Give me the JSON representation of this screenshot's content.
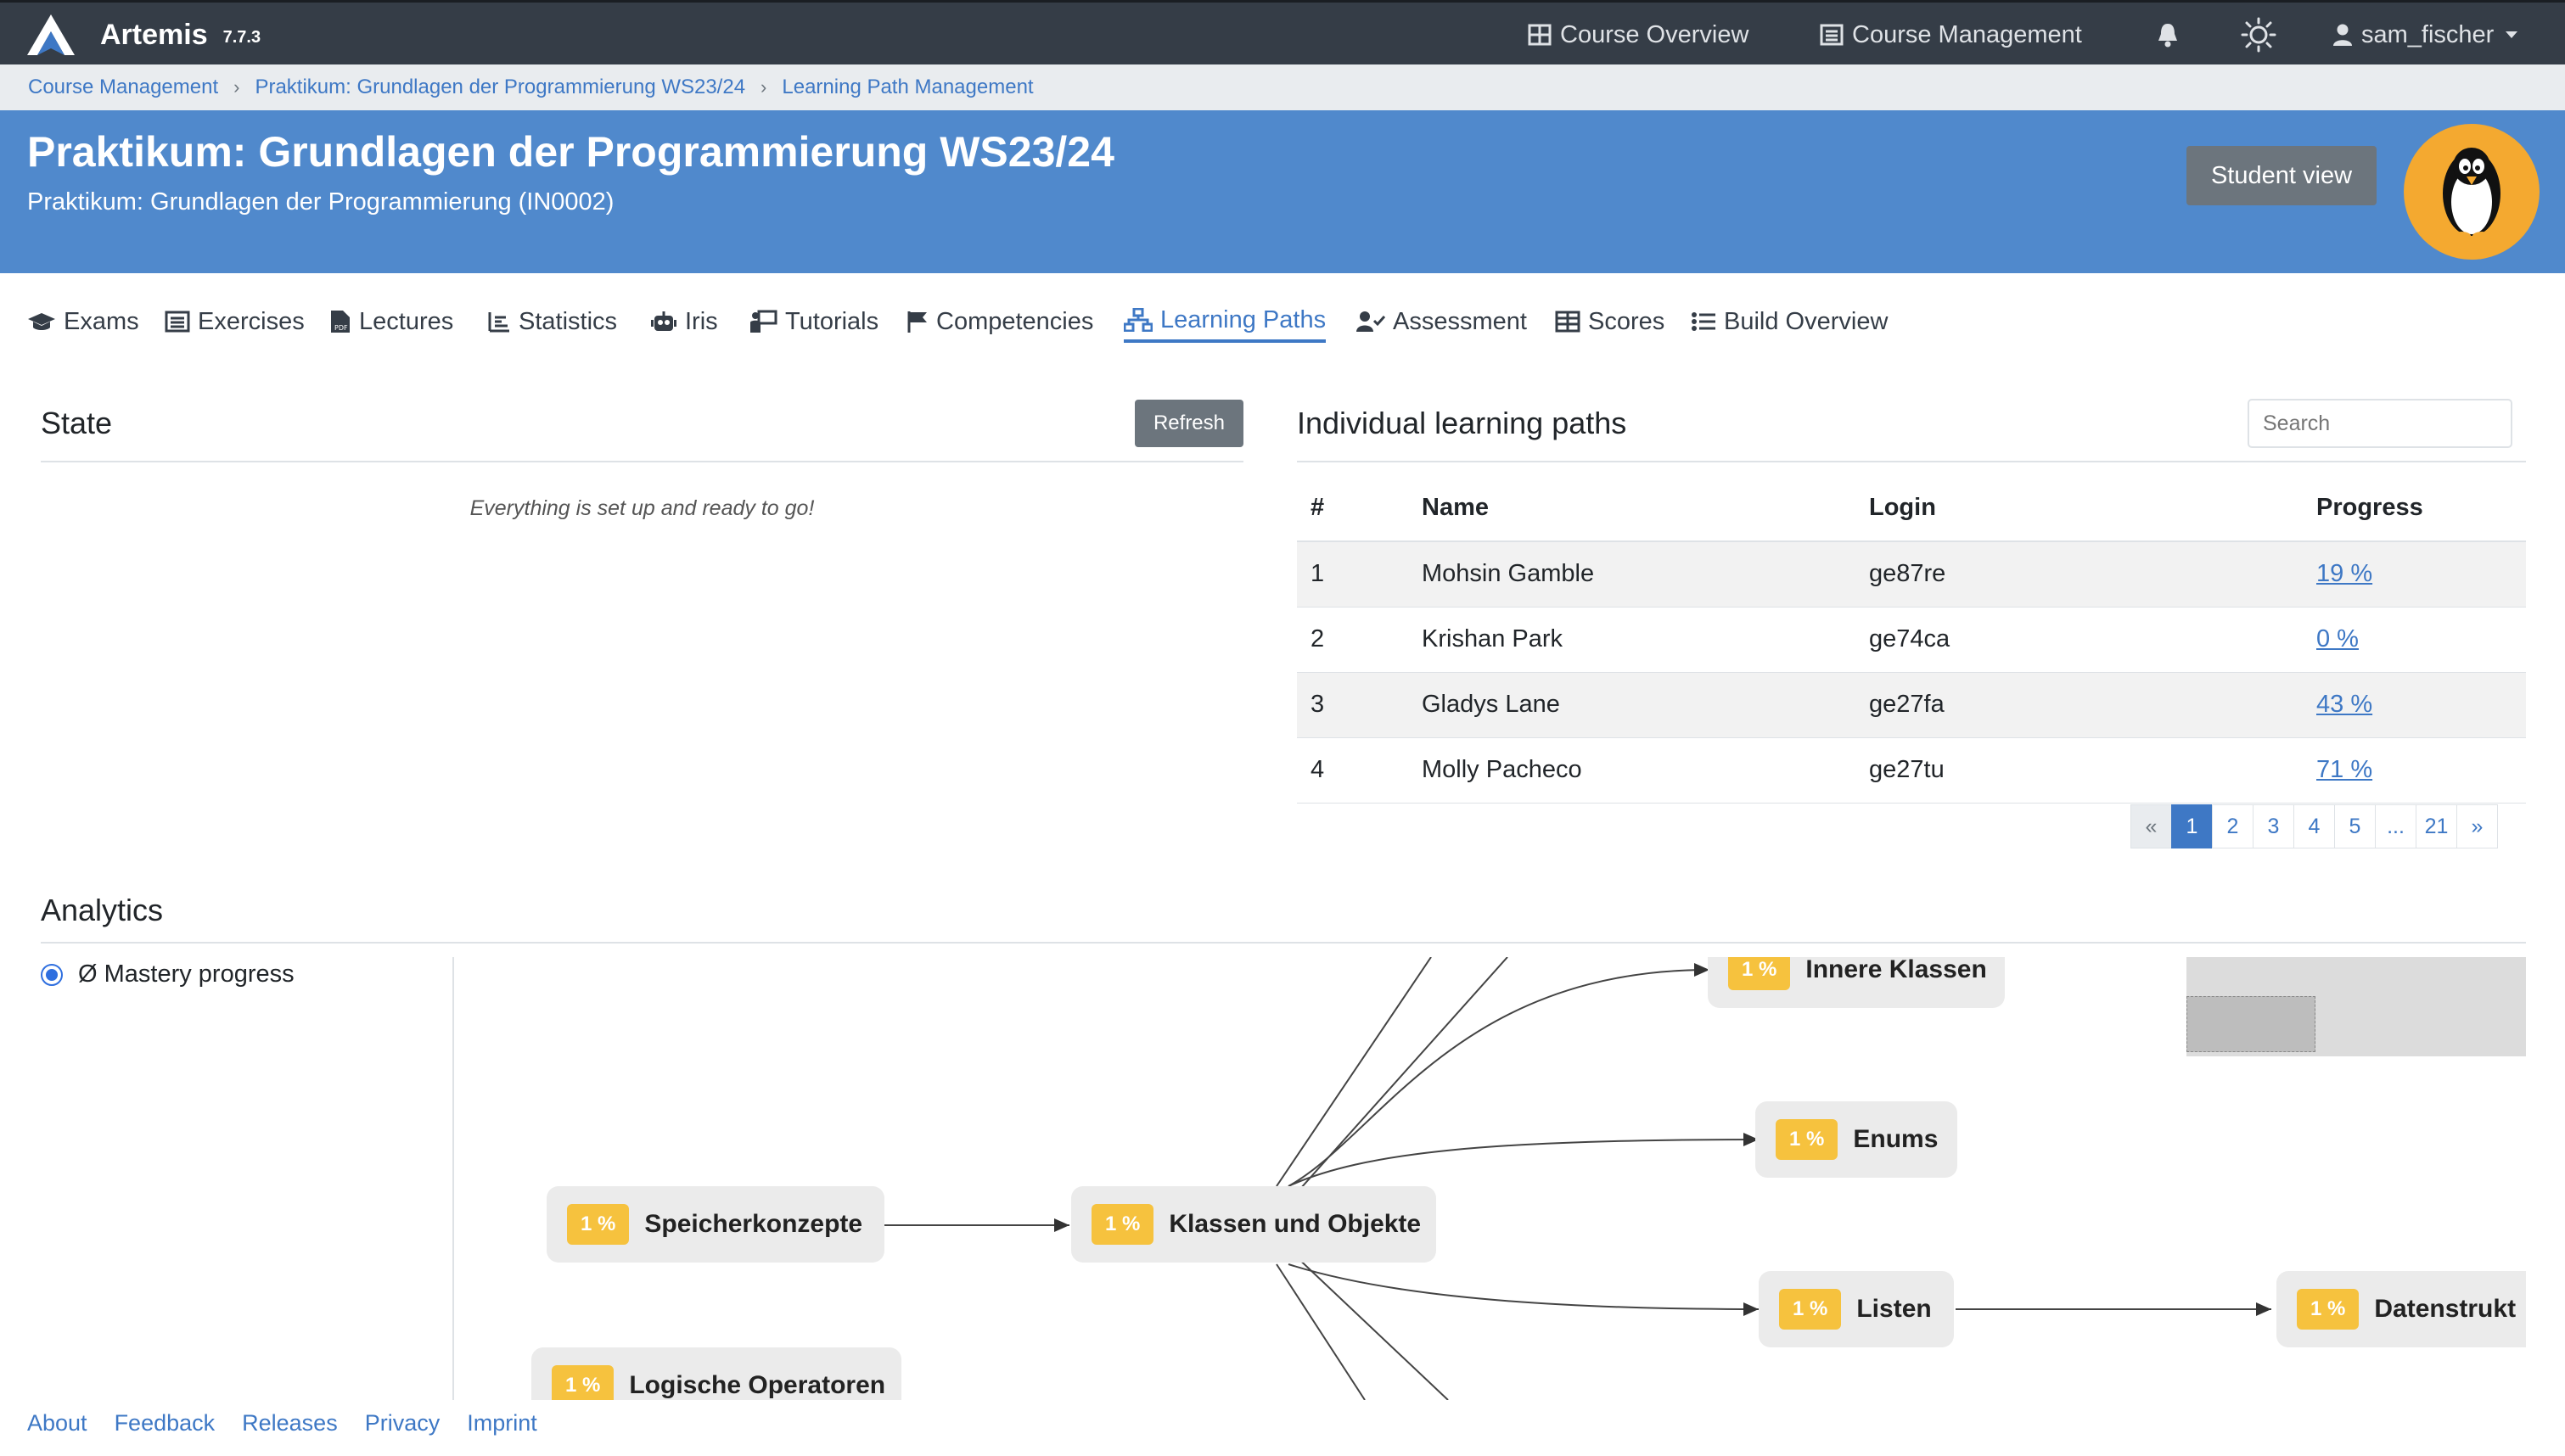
{
  "app": {
    "name": "Artemis",
    "version": "7.7.3"
  },
  "navbar": {
    "course_overview": "Course Overview",
    "course_management": "Course Management",
    "user": "sam_fischer"
  },
  "breadcrumb": [
    "Course Management",
    "Praktikum: Grundlagen der Programmierung WS23/24",
    "Learning Path Management"
  ],
  "course": {
    "title": "Praktikum: Grundlagen der Programmierung WS23/24",
    "subtitle": "Praktikum: Grundlagen der Programmierung (IN0002)",
    "student_view": "Student view",
    "header_color": "#5089cc",
    "icon": "penguin-icon"
  },
  "tabs": [
    {
      "label": "Exams",
      "icon": "graduation-cap-icon"
    },
    {
      "label": "Exercises",
      "icon": "list-alt-icon"
    },
    {
      "label": "Lectures",
      "icon": "file-pdf-icon"
    },
    {
      "label": "Statistics",
      "icon": "chart-icon"
    },
    {
      "label": "Iris",
      "icon": "robot-icon"
    },
    {
      "label": "Tutorials",
      "icon": "chalkboard-icon"
    },
    {
      "label": "Competencies",
      "icon": "flag-icon"
    },
    {
      "label": "Learning Paths",
      "icon": "sitemap-icon",
      "active": true
    },
    {
      "label": "Assessment",
      "icon": "user-check-icon"
    },
    {
      "label": "Scores",
      "icon": "table-icon"
    },
    {
      "label": "Build Overview",
      "icon": "list-icon"
    }
  ],
  "state": {
    "title": "State",
    "refresh": "Refresh",
    "message": "Everything is set up and ready to go!"
  },
  "learning_paths": {
    "title": "Individual learning paths",
    "search_placeholder": "Search",
    "columns": [
      "#",
      "Name",
      "Login",
      "Progress"
    ],
    "rows": [
      {
        "num": "1",
        "name": "Mohsin Gamble",
        "login": "ge87re",
        "progress": "19 %"
      },
      {
        "num": "2",
        "name": "Krishan Park",
        "login": "ge74ca",
        "progress": "0 %"
      },
      {
        "num": "3",
        "name": "Gladys Lane",
        "login": "ge27fa",
        "progress": "43 %"
      },
      {
        "num": "4",
        "name": "Molly Pacheco",
        "login": "ge27tu",
        "progress": "71 %"
      }
    ],
    "pagination": [
      "«",
      "1",
      "2",
      "3",
      "4",
      "5",
      "...",
      "21",
      "»"
    ],
    "current_page": "1"
  },
  "analytics": {
    "title": "Analytics",
    "option": "Ø Mastery progress",
    "nodes": [
      {
        "id": "innere",
        "label": "Innere Klassen",
        "pct": "1 %"
      },
      {
        "id": "enums",
        "label": "Enums",
        "pct": "1 %"
      },
      {
        "id": "speicher",
        "label": "Speicherkonzepte",
        "pct": "1 %"
      },
      {
        "id": "klassen",
        "label": "Klassen und Objekte",
        "pct": "1 %"
      },
      {
        "id": "listen",
        "label": "Listen",
        "pct": "1 %"
      },
      {
        "id": "datenstr",
        "label": "Datenstrukt",
        "pct": "1 %"
      },
      {
        "id": "logisch",
        "label": "Logische Operatoren",
        "pct": "1 %"
      }
    ],
    "accent": "#f6c23e"
  },
  "footer": [
    "About",
    "Feedback",
    "Releases",
    "Privacy",
    "Imprint"
  ],
  "colors": {
    "navbar": "#353d47",
    "link": "#3e78c5",
    "primary": "#3e78c5"
  }
}
